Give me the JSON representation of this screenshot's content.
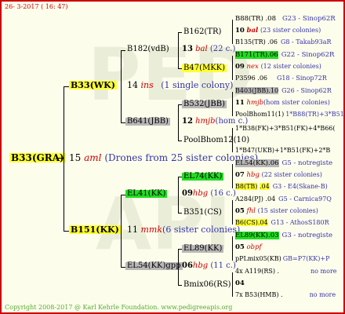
{
  "header": "26-  3-2017  ( 16: 47)",
  "footer": "Copyright 2008-2017 @ Karl Kehrle Foundation.   www.pedigreeapis.org",
  "root": {
    "name": "B33(GRA)",
    "num": "15",
    "code": "aml",
    "info": "(Drones from 25 sister colonies)"
  },
  "g1": [
    {
      "name": "B33(WK)",
      "num": "14",
      "code": "ins",
      "info": "(1 single colony)"
    },
    {
      "name": "B151(KK)",
      "num": "11",
      "code": "mmk",
      "info": "(6 sister colonies)"
    }
  ],
  "g2": [
    {
      "name": "B182(vdB)",
      "num": "13",
      "code": "bal",
      "info": "(22 c.)"
    },
    {
      "name": "B641(JBB)",
      "num": "12",
      "code": "hmjb",
      "info": "(hom c.)"
    },
    {
      "name": "EL41(KK)",
      "num": "09",
      "code": "hbg",
      "info": "(16 c.)"
    },
    {
      "name": "EL54(KK)gpp",
      "num": "06",
      "code": "hbg",
      "info": "(11 c.)"
    }
  ],
  "g3": [
    "B162(TR)",
    "B47(MKK)",
    "B532(JBB)",
    "PoolBhom12(10)",
    "EL74(KK)",
    "B351(CS)",
    "EL89(KK)",
    "Bmix06(RS)"
  ],
  "g4": [
    {
      "line1": {
        "name": "B88(TR)",
        "y": ".08",
        "ref": "G23 - Sinop62R"
      },
      "num": "10",
      "code": "bal",
      "info": "(23 sister colonies)",
      "line3": {
        "name": "B135(TR)",
        "y": ".06",
        "ref": "G8 - Takab93aR"
      }
    },
    {
      "line1": {
        "name": "B171(TR)",
        "y": ".06",
        "ref": "G22 - Sinop62R"
      },
      "num": "09",
      "code": "nex",
      "info": "(12 sister colonies)",
      "line3": {
        "name": "P3596",
        "y": ".06",
        "ref": "G18 - Sinop72R"
      }
    },
    {
      "line1": {
        "name": "B403(JBB)",
        "y": ".10",
        "ref": "G26 - Sinop62R"
      },
      "num": "11",
      "code": "hmjb",
      "info": "(hom sister colonies)",
      "line3": {
        "name": "PoolBhom11(1)",
        "y": "",
        "ref": "1*B88(TR)+3*B51(FK)+5"
      }
    },
    {
      "line1": {
        "name": "1*B38(FK)+3*B51(FK)+4*B66(",
        "y": "",
        "ref": ""
      },
      "num": "",
      "code": "",
      "info": "",
      "line3": {
        "name": "1*B47(UKB)+1*B51(FK)+2*B",
        "y": "",
        "ref": ""
      }
    },
    {
      "line1": {
        "name": "EL54(KK)",
        "y": ".06",
        "ref": "G5 - notregiste"
      },
      "num": "07",
      "code": "hbg",
      "info": "(22 sister colonies)",
      "line3": {
        "name": "B8(TB)",
        "y": ".04",
        "ref": "G3 - E4(Skane-B)"
      }
    },
    {
      "line1": {
        "name": "A284(PJ)",
        "y": ".04",
        "ref": "G5 - Carnica97Q"
      },
      "num": "05",
      "code": "fhl",
      "info": "(15 sister colonies)",
      "line3": {
        "name": "B6(CS)",
        "y": ".04",
        "ref": "G13 - AthosS180R"
      }
    },
    {
      "line1": {
        "name": "EL89(KK)",
        "y": ".03",
        "ref": "G3 - notregiste"
      },
      "num": "05",
      "code": "obpf",
      "info": "",
      "line3": {
        "name": "pPLmix05(KB)",
        "y": "",
        "ref": "GB=P7(KK)+P"
      }
    },
    {
      "line1": {
        "name": "4x A119(RS)",
        "y": ".",
        "ref": "no more"
      },
      "num": "04",
      "code": "",
      "info": "",
      "line3": {
        "name": "7x B53(HMB)",
        "y": ".",
        "ref": "no more"
      }
    }
  ]
}
